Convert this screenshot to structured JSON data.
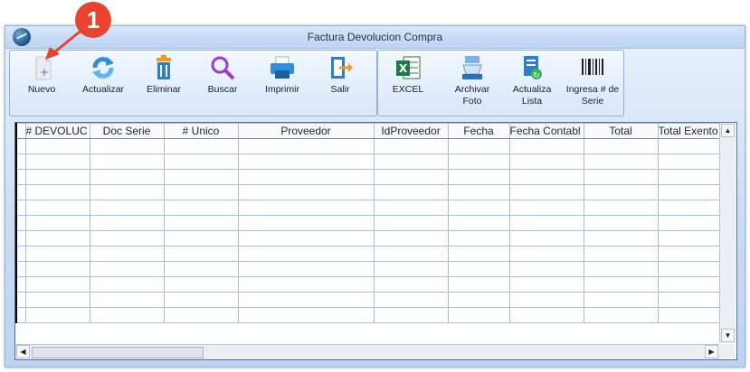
{
  "window": {
    "title": "Factura Devolucion Compra"
  },
  "annotation": {
    "badge_number": "1"
  },
  "toolbar": {
    "main": [
      {
        "id": "nuevo",
        "label": "Nuevo",
        "icon": "new-document-icon"
      },
      {
        "id": "actualizar",
        "label": "Actualizar",
        "icon": "refresh-icon"
      },
      {
        "id": "eliminar",
        "label": "Eliminar",
        "icon": "trash-icon"
      },
      {
        "id": "buscar",
        "label": "Buscar",
        "icon": "search-icon"
      },
      {
        "id": "imprimir",
        "label": "Imprimir",
        "icon": "printer-icon"
      },
      {
        "id": "salir",
        "label": "Salir",
        "icon": "exit-icon"
      }
    ],
    "extra": [
      {
        "id": "excel",
        "label": "EXCEL",
        "icon": "excel-icon"
      },
      {
        "id": "archivar_foto",
        "label": "Archivar Foto",
        "icon": "scanner-icon"
      },
      {
        "id": "actualiza_lista",
        "label": "Actualiza Lista",
        "icon": "refresh-list-icon"
      },
      {
        "id": "ingresa_serie",
        "label": "Ingresa # de Serie",
        "icon": "barcode-icon"
      }
    ]
  },
  "grid": {
    "columns": [
      "# DEVOLUC",
      "Doc Serie",
      "# Unico",
      "Proveedor",
      "IdProveedor",
      "Fecha",
      "Fecha Contabl",
      "Total",
      "Total Exento"
    ],
    "rows": [
      [],
      [],
      [],
      [],
      [],
      [],
      [],
      [],
      [],
      [],
      [],
      []
    ]
  },
  "colors": {
    "accent": "#e8432f",
    "window_bg": "#c9dcf5",
    "grid_line": "#a4bedf"
  }
}
